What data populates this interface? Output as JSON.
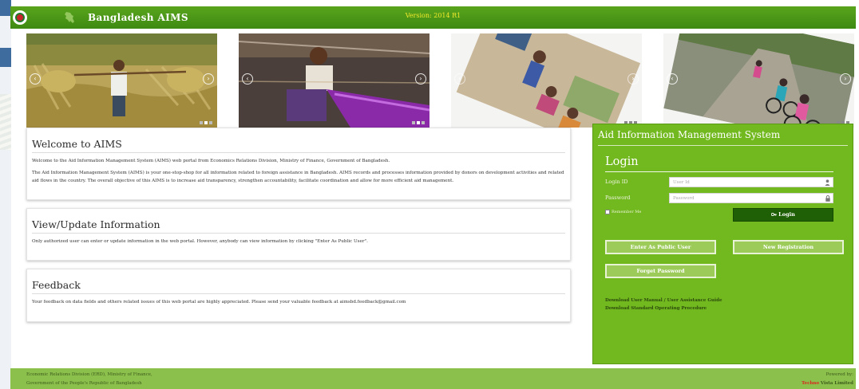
{
  "header": {
    "title": "Bangladesh  AIMS",
    "version": "Version: 2014 R1",
    "bg_color": "#4a9718",
    "version_color": "#f3ea2c"
  },
  "carousel": {
    "slides": [
      {
        "name": "slide-farmer-harvest",
        "prev_icon": "chevron-left-icon",
        "next_icon": "chevron-right-icon"
      },
      {
        "name": "slide-weaver-loom",
        "prev_icon": "chevron-left-icon",
        "next_icon": "chevron-right-icon"
      },
      {
        "name": "slide-solar-panel-women",
        "prev_icon": "chevron-left-icon",
        "next_icon": "chevron-right-icon"
      },
      {
        "name": "slide-girls-cycling",
        "prev_icon": "chevron-left-icon",
        "next_icon": "chevron-right-icon"
      }
    ]
  },
  "welcome": {
    "title": "Welcome to AIMS",
    "para1": "Welcome to the Aid Information Management System (AIMS) web portal from Economics Relations Division, Ministry of Finance, Government of Bangladesh.",
    "para2": "The Aid Information Management System (AIMS) is your one-stop-shop for all information related to foreign assistance in Bangladesh. AIMS records and processes information provided by donors on development activities and related aid flows in the country. The overall objective of this AIMS is to increase aid transparency, strengthen accountability, facilitate coordination and allow for more efficient aid management."
  },
  "view_update": {
    "title": "View/Update Information",
    "text": "Only authorized user can enter or update information in the web portal. However, anybody can view information by clicking \"Enter As Public User\"."
  },
  "feedback": {
    "title": "Feedback",
    "text": "Your feedback on data fields and others related issues of this web portal are highly appreciated. Please send your valuable feedback at aimsbd.feedback@gmail.com"
  },
  "login": {
    "system_title": "Aid Information Management System",
    "title": "Login",
    "login_id_label": "Login ID",
    "login_id_placeholder": "User Id",
    "password_label": "Password",
    "password_placeholder": "Password",
    "remember_label": "Remember Me",
    "login_button": "Login",
    "public_user_button": "Enter As Public User",
    "new_registration_button": "New Registration",
    "forget_password_button": "Forget Password",
    "download_manual": "Download User Manual / User Assistance Guide",
    "download_sop": "Download Standard Operating Procedure",
    "panel_color": "#72b81f",
    "login_button_color": "#1f5f06",
    "user_icon": "user-icon",
    "lock_icon": "lock-icon",
    "key_icon": "key-icon"
  },
  "footer": {
    "org_line1": "Economic Relations Division (ERD), Ministry of Finance,",
    "org_line2": "Government of the People's Republic of Bangladesh",
    "powered_by": "Powered by:",
    "brand_part1": "Techno",
    "brand_part2": "Vista Limited",
    "bg_color": "#8cc04d"
  }
}
